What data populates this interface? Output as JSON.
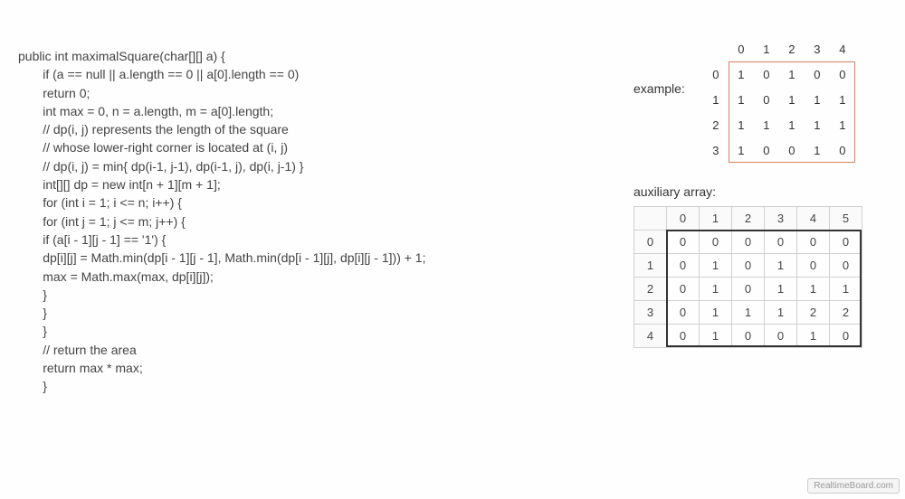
{
  "code": [
    "public int maximalSquare(char[][] a) {",
    "       if (a == null || a.length == 0 || a[0].length == 0)",
    "       return 0;",
    "",
    "       int max = 0, n = a.length, m = a[0].length;",
    "",
    "       // dp(i, j) represents the length of the square",
    "       // whose lower-right corner is located at (i, j)",
    "       // dp(i, j) = min{ dp(i-1, j-1), dp(i-1, j), dp(i, j-1) }",
    "       int[][] dp = new int[n + 1][m + 1];",
    "",
    "       for (int i = 1; i <= n; i++) {",
    "       for (int j = 1; j <= m; j++) {",
    "       if (a[i - 1][j - 1] == '1') {",
    "       dp[i][j] = Math.min(dp[i - 1][j - 1], Math.min(dp[i - 1][j], dp[i][j - 1])) + 1;",
    "       max = Math.max(max, dp[i][j]);",
    "       }",
    "       }",
    "       }",
    "",
    "       // return the area",
    "       return max * max;",
    "       }"
  ],
  "labels": {
    "example": "example:",
    "auxiliary": "auxiliary array:"
  },
  "example": {
    "col_headers": [
      "0",
      "1",
      "2",
      "3",
      "4"
    ],
    "row_headers": [
      "0",
      "1",
      "2",
      "3"
    ],
    "rows": [
      [
        "1",
        "0",
        "1",
        "0",
        "0"
      ],
      [
        "1",
        "0",
        "1",
        "1",
        "1"
      ],
      [
        "1",
        "1",
        "1",
        "1",
        "1"
      ],
      [
        "1",
        "0",
        "0",
        "1",
        "0"
      ]
    ]
  },
  "auxiliary": {
    "col_headers": [
      "0",
      "1",
      "2",
      "3",
      "4",
      "5"
    ],
    "row_headers": [
      "0",
      "1",
      "2",
      "3",
      "4"
    ],
    "rows": [
      [
        "0",
        "0",
        "0",
        "0",
        "0",
        "0"
      ],
      [
        "0",
        "1",
        "0",
        "1",
        "0",
        "0"
      ],
      [
        "0",
        "1",
        "0",
        "1",
        "1",
        "1"
      ],
      [
        "0",
        "1",
        "1",
        "1",
        "2",
        "2"
      ],
      [
        "0",
        "1",
        "0",
        "0",
        "1",
        "0"
      ]
    ]
  },
  "watermark": "RealtimeBoard.com"
}
